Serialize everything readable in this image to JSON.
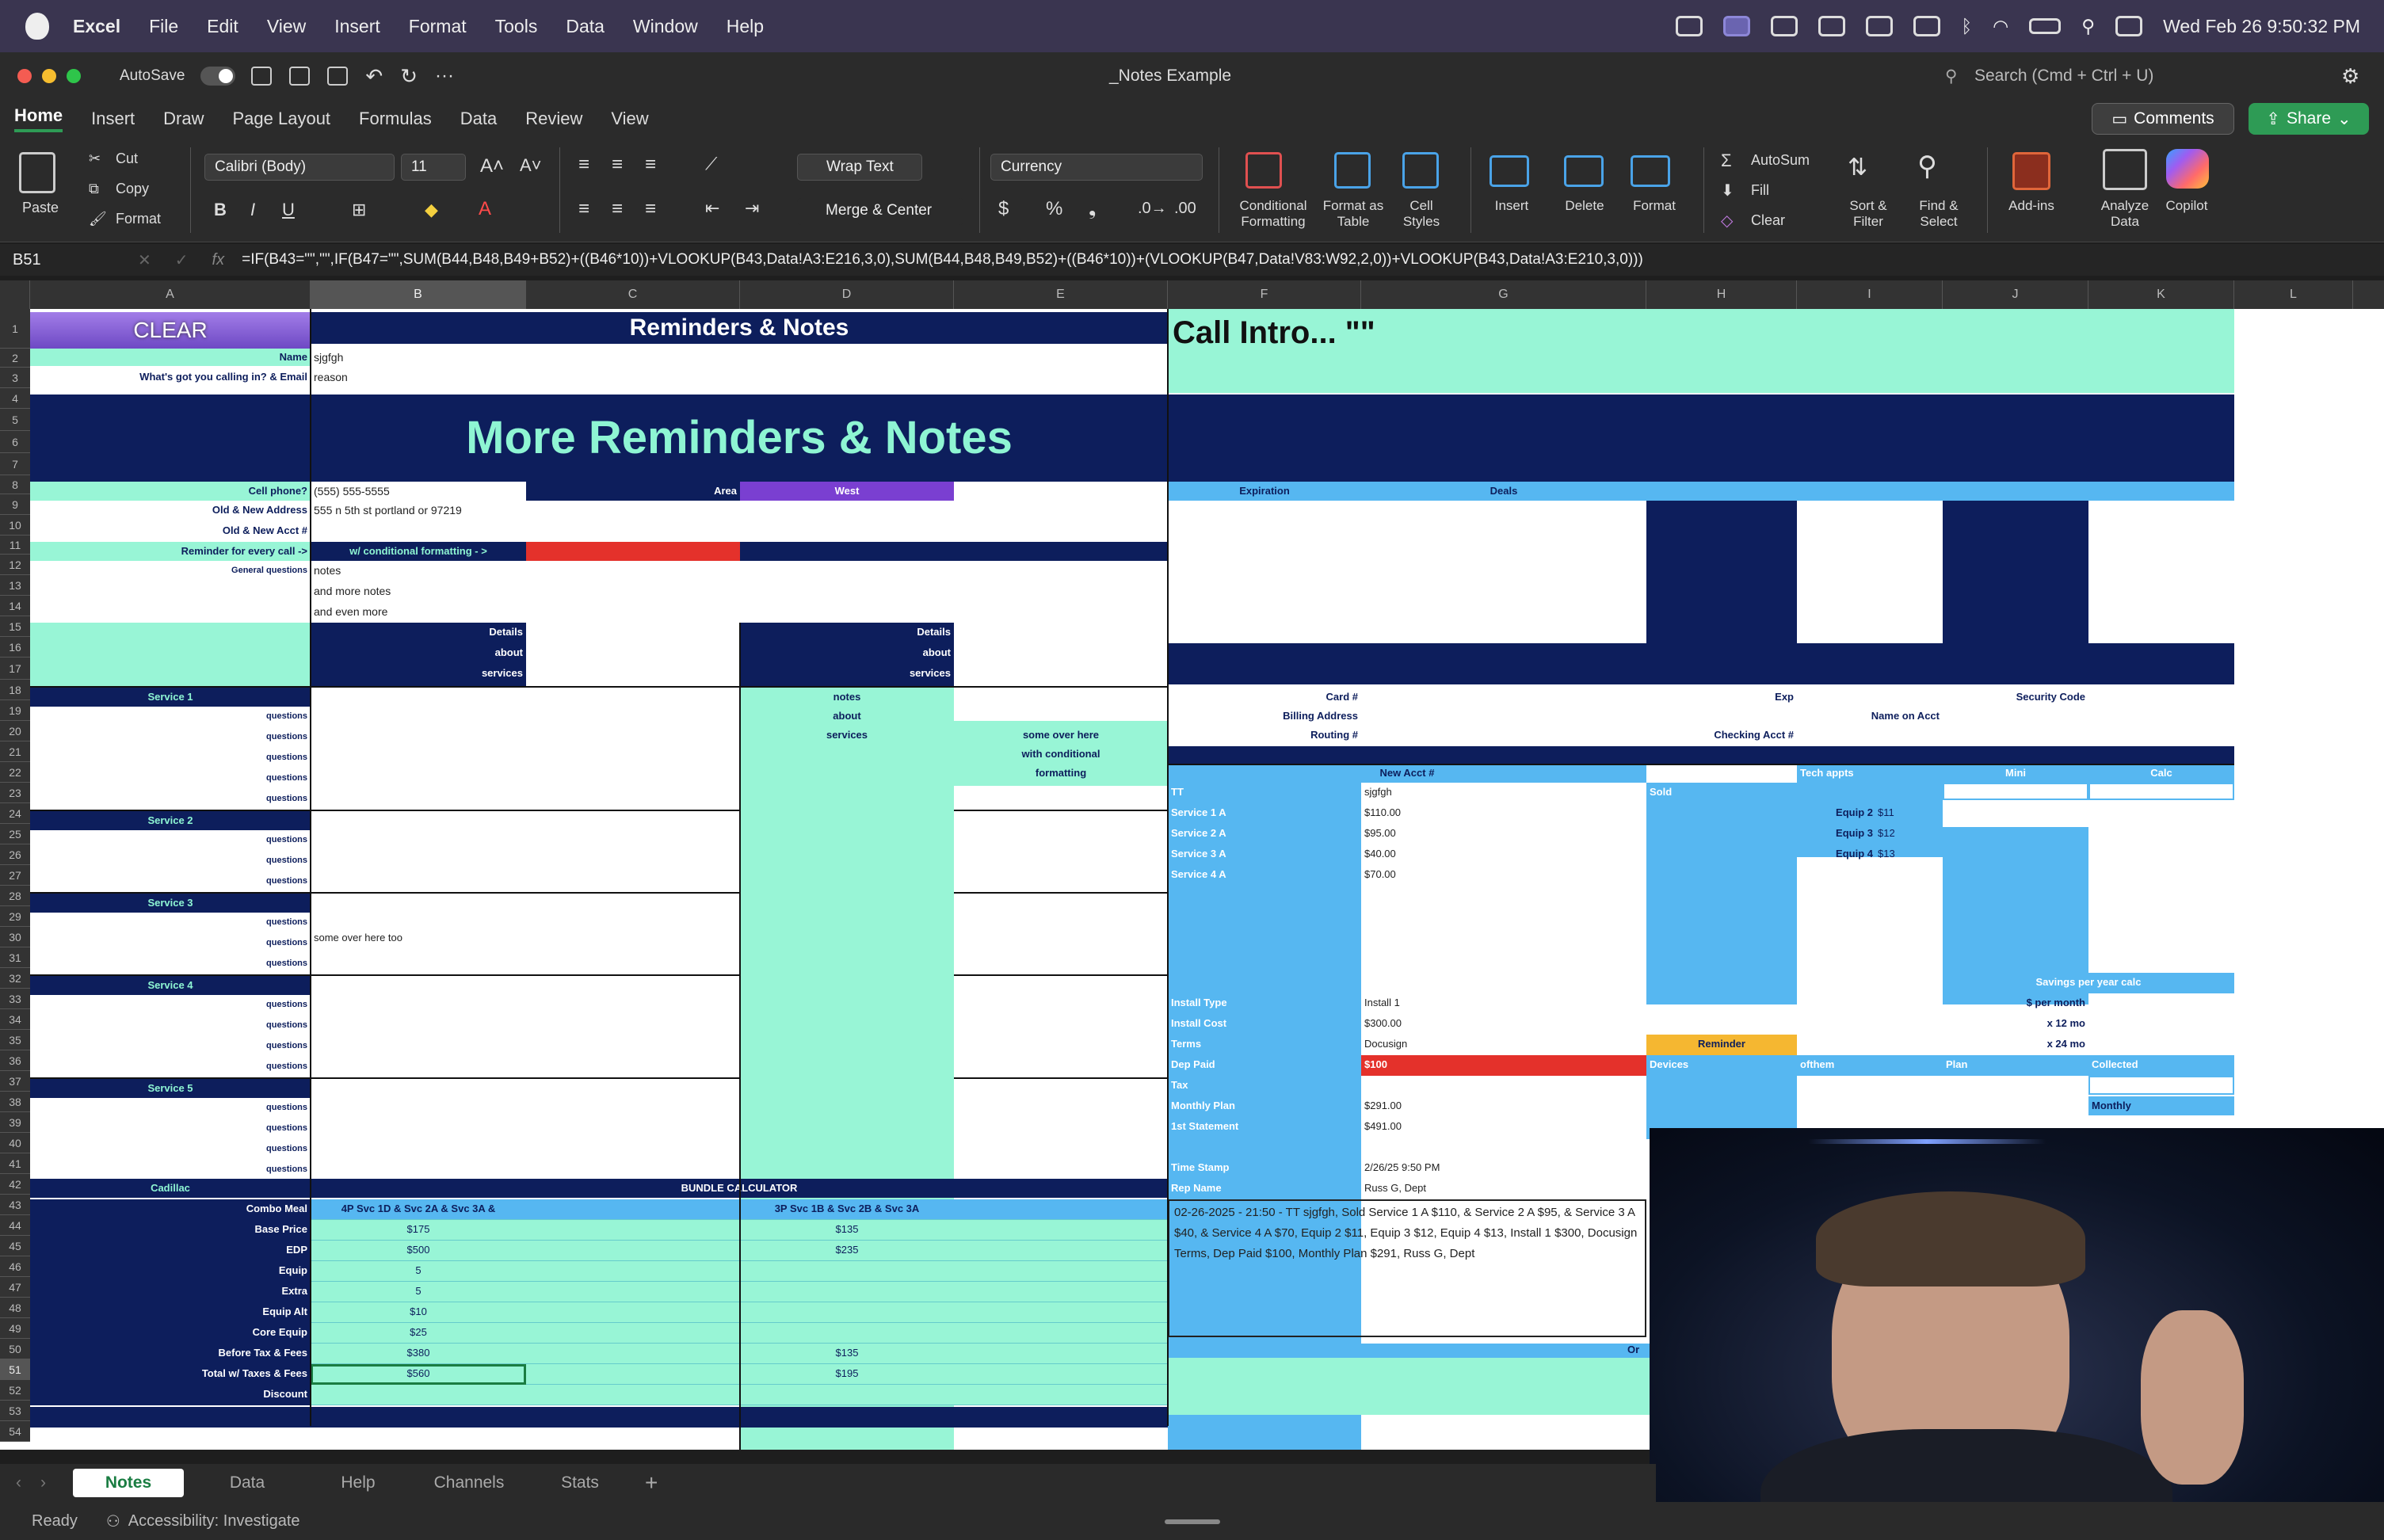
{
  "menubar": {
    "app": "Excel",
    "items": [
      "File",
      "Edit",
      "View",
      "Insert",
      "Format",
      "Tools",
      "Data",
      "Window",
      "Help"
    ],
    "clock": "Wed Feb 26  9:50:32 PM"
  },
  "titlebar": {
    "autosave": "AutoSave",
    "doc_title": "_Notes Example",
    "search_placeholder": "Search (Cmd + Ctrl + U)"
  },
  "ribbon_tabs": [
    "Home",
    "Insert",
    "Draw",
    "Page Layout",
    "Formulas",
    "Data",
    "Review",
    "View"
  ],
  "comments": "Comments",
  "share": "Share",
  "ribbon": {
    "paste": "Paste",
    "cut": "Cut",
    "copy": "Copy",
    "format": "Format",
    "font": "Calibri (Body)",
    "size": "11",
    "wrap": "Wrap Text",
    "merge": "Merge & Center",
    "number_format": "Currency",
    "cond": "Conditional Formatting",
    "fmt_table": "Format as Table",
    "cell_styles": "Cell Styles",
    "insert": "Insert",
    "delete": "Delete",
    "format2": "Format",
    "autosum": "AutoSum",
    "fill": "Fill",
    "clear": "Clear",
    "sort": "Sort & Filter",
    "find": "Find & Select",
    "addins": "Add-ins",
    "analyze": "Analyze Data",
    "copilot": "Copilot"
  },
  "formula_bar": {
    "cell_ref": "B51",
    "formula": "=IF(B43=\"\",\"\",IF(B47=\"\",SUM(B44,B48,B49+B52)+((B46*10))+VLOOKUP(B43,Data!A3:E216,3,0),SUM(B44,B48,B49,B52)+((B46*10))+(VLOOKUP(B47,Data!V83:W92,2,0))+VLOOKUP(B43,Data!A3:E210,3,0)))"
  },
  "columns": [
    "A",
    "B",
    "C",
    "D",
    "E",
    "F",
    "G",
    "H",
    "I",
    "J",
    "K",
    "L"
  ],
  "sheet": {
    "clear": "CLEAR",
    "reminders_title": "Reminders & Notes",
    "call_intro": "Call Intro... \"\"",
    "more_title": "More Reminders & Notes",
    "name_lbl": "Name",
    "name_val": "sjgfgh",
    "calling_lbl": "What's got you calling in? & Email",
    "calling_val": "reason",
    "cell_lbl": "Cell phone?",
    "cell_val": "(555) 555-5555",
    "area_lbl": "Area",
    "area_val": "West",
    "addr_lbl": "Old & New Address",
    "addr_val": "555 n 5th st portland or 97219",
    "acct_lbl": "Old & New Acct #",
    "rem_lbl": "Reminder for every call ->",
    "rem_val": "w/ conditional formatting - >",
    "gen_lbl": "General questions",
    "notes1": "notes",
    "notes2": "and more notes",
    "notes3": "and even more",
    "details": [
      "Details",
      "about",
      "services"
    ],
    "notes_about": [
      "notes",
      "about",
      "services"
    ],
    "some_over": [
      "some over here",
      "with conditional",
      "formatting"
    ],
    "services": [
      "Service 1",
      "Service 2",
      "Service 3",
      "Service 4",
      "Service 5"
    ],
    "questions": "questions",
    "some_over_too": "some over here too",
    "cadillac": "Cadillac",
    "bundle_calc": "BUNDLE CALCULATOR",
    "bundle_rows": [
      "Combo Meal",
      "Base Price",
      "EDP",
      "Equip",
      "Extra",
      "Equip Alt",
      "Core Equip",
      "Before Tax & Fees",
      "Total w/ Taxes & Fees",
      "Discount"
    ],
    "bundle_b": [
      "4P Svc 1D & Svc 2A & Svc 3A &",
      "$175",
      "$500",
      "5",
      "5",
      "$10",
      "$25",
      "$380",
      "$560",
      ""
    ],
    "bundle_d": [
      "3P Svc 1B & Svc 2B & Svc 3A",
      "$135",
      "$235",
      "",
      "",
      "",
      "",
      "$135",
      "$195",
      ""
    ],
    "expiration": "Expiration",
    "deals": "Deals",
    "card_lbl": "Card #",
    "exp_lbl": "Exp",
    "sec_lbl": "Security Code",
    "billing_lbl": "Billing Address",
    "name_acct": "Name on Acct",
    "routing_lbl": "Routing #",
    "checking_lbl": "Checking Acct #",
    "new_acct": "New Acct #",
    "tech_appts": "Tech appts",
    "mini": "Mini",
    "calc": "Calc",
    "tt": "TT",
    "tt_val": "sjgfgh",
    "sold": "Sold",
    "svc_rows": [
      [
        "Service 1 A",
        "$110.00",
        "Equip 2",
        "$11"
      ],
      [
        "Service 2 A",
        "$95.00",
        "Equip 3",
        "$12"
      ],
      [
        "Service 3 A",
        "$40.00",
        "Equip 4",
        "$13"
      ],
      [
        "Service 4 A",
        "$70.00",
        "",
        ""
      ]
    ],
    "savings": "Savings per year calc",
    "per_month": "$ per month",
    "x12": "x 12 mo",
    "x24": "x 24 mo",
    "install_type": "Install Type",
    "install_type_val": "Install 1",
    "install_cost": "Install Cost",
    "install_cost_val": "$300.00",
    "terms": "Terms",
    "terms_val": "Docusign",
    "reminder": "Reminder",
    "dep_paid": "Dep Paid",
    "dep_paid_val": "$100",
    "devices": "Devices",
    "ofthem": "ofthem",
    "plan": "Plan",
    "collected": "Collected",
    "monthly": "Monthly",
    "tax": "Tax",
    "monthly_plan": "Monthly Plan",
    "monthly_plan_val": "$291.00",
    "first_stmt": "1st Statement",
    "first_stmt_val": "$491.00",
    "timestamp": "Time Stamp",
    "timestamp_val": "2/26/25 9:50 PM",
    "rep_name": "Rep Name",
    "rep_name_val": "Russ G, Dept",
    "summary": "02-26-2025 - 21:50 - TT sjgfgh, Sold Service 1 A $110, & Service 2 A $95, & Service 3 A $40, & Service 4 A $70, Equip 2 $11, Equip 3 $12, Equip 4 $13, Install 1 $300, Docusign Terms, Dep Paid $100, Monthly Plan $291, Russ G, Dept",
    "or": "Or"
  },
  "sheet_tabs": [
    "Notes",
    "Data",
    "Help",
    "Channels",
    "Stats"
  ],
  "status": {
    "ready": "Ready",
    "accessibility": "Accessibility: Investigate"
  },
  "colors": {
    "navy": "#0d1e5c",
    "mint": "#98f5d6",
    "sky": "#56b7f1",
    "purple": "#7a3fd1",
    "red": "#e4312b",
    "orange": "#f5b731",
    "share_green": "#2e9b55"
  }
}
